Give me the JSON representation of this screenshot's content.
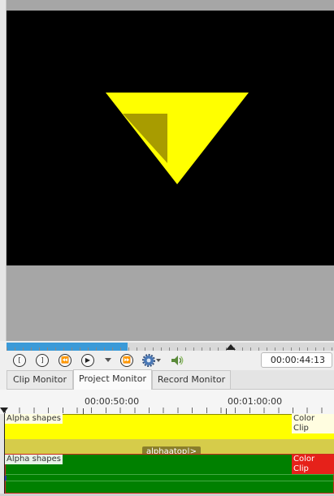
{
  "monitor": {
    "triangle_color": "#ffff00",
    "overlay_color": "#a89c00"
  },
  "controls": {
    "buttons": [
      {
        "name": "in-point-icon",
        "glyph": "[",
        "color": "#333333"
      },
      {
        "name": "out-point-icon",
        "glyph": "]",
        "color": "#333333"
      },
      {
        "name": "rewind-icon",
        "glyph": "⏪",
        "color": "#333333"
      },
      {
        "name": "play-icon",
        "glyph": "▶",
        "color": "#333333"
      },
      {
        "name": "forward-icon",
        "glyph": "⏩",
        "color": "#333333"
      }
    ],
    "timecode": "00:00:44:13",
    "position_fraction": 0.37
  },
  "tabs": [
    {
      "label": "Clip Monitor",
      "active": false
    },
    {
      "label": "Project Monitor",
      "active": true
    },
    {
      "label": "Record Monitor",
      "active": false
    }
  ],
  "timeline": {
    "ruler_labels": [
      "00:00:50:00",
      "00:01:00:00"
    ],
    "clips": [
      {
        "name": "Alpha shapes",
        "type": "Color Clip",
        "color": "#ffff00"
      },
      {
        "name": "Alpha shapes",
        "type": "Color Clip",
        "color": "#008000"
      }
    ],
    "composition": "alphaatop|>"
  }
}
